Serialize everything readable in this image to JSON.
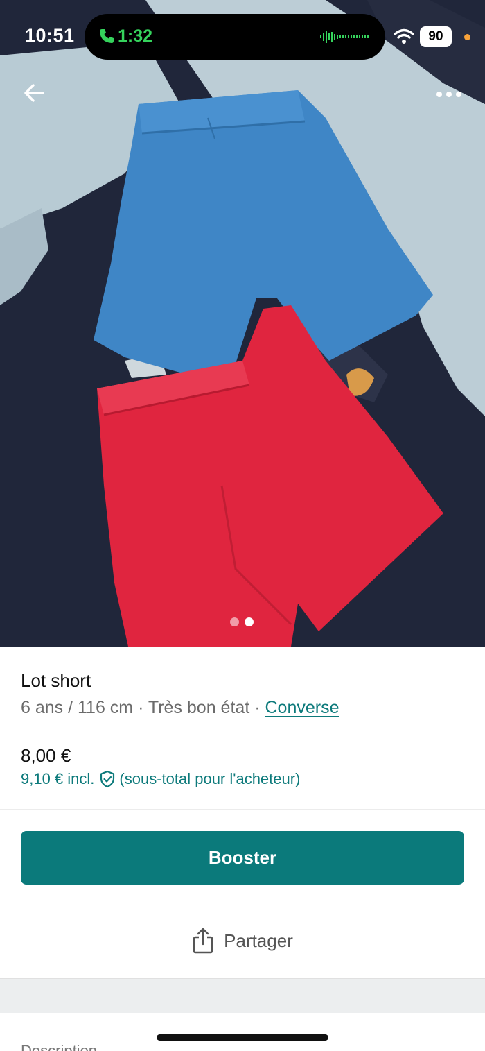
{
  "status_bar": {
    "time": "10:51",
    "call_duration": "1:32",
    "battery": "90",
    "call_color": "#35d35c",
    "battery_dot_color": "#f7a23a"
  },
  "photo": {
    "icons": {
      "back": "arrow-left-icon",
      "more": "more-horizontal-icon"
    },
    "image_count": 2,
    "active_image": 2
  },
  "item": {
    "title": "Lot short",
    "meta_prefix": "6 ans / 116 cm · Très bon état · ",
    "brand": "Converse",
    "price": "8,00 €",
    "price_incl": "9,10 € incl.",
    "price_incl_note": "(sous-total pour l'acheteur)"
  },
  "actions": {
    "booster_label": "Booster",
    "share_label": "Partager"
  },
  "description": {
    "label": "Description"
  },
  "colors": {
    "accent": "#0b7a7b",
    "link": "#0d7a7b"
  }
}
